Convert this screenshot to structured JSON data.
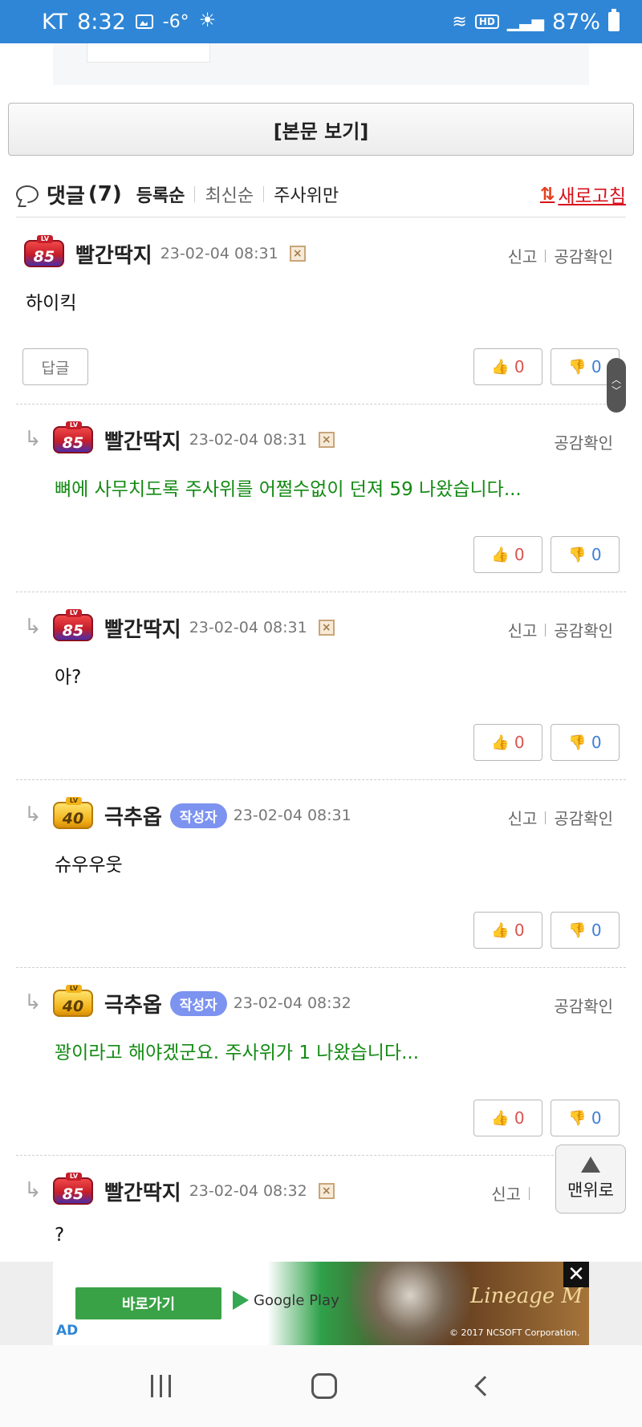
{
  "status_bar": {
    "carrier": "KT",
    "time": "8:32",
    "temperature": "-6°",
    "hd": "HD",
    "battery": "87%"
  },
  "view_body_button": "[본문 보기]",
  "comments_header": {
    "title": "댓글",
    "count": "(7)",
    "sort_options": [
      "등록순",
      "최신순",
      "주사위만"
    ],
    "refresh_label": "새로고침"
  },
  "labels": {
    "report": "신고",
    "sympathy": "공감확인",
    "reply": "답글",
    "author": "작성자",
    "lv": "LV"
  },
  "comments": [
    {
      "level": "85",
      "nick": "빨간딱지",
      "date": "23-02-04 08:31",
      "text": "하이킥",
      "up": "0",
      "down": "0"
    },
    {
      "level": "85",
      "nick": "빨간딱지",
      "date": "23-02-04 08:31",
      "text": "뼈에 사무치도록 주사위를 어쩔수없이 던져 59 나왔습니다...",
      "up": "0",
      "down": "0"
    },
    {
      "level": "85",
      "nick": "빨간딱지",
      "date": "23-02-04 08:31",
      "text": "아?",
      "up": "0",
      "down": "0"
    },
    {
      "level": "40",
      "nick": "극추옵",
      "date": "23-02-04 08:31",
      "text": "슈우우웃",
      "up": "0",
      "down": "0"
    },
    {
      "level": "40",
      "nick": "극추옵",
      "date": "23-02-04 08:32",
      "text": "꽝이라고 해야겠군요. 주사위가 1 나왔습니다...",
      "up": "0",
      "down": "0"
    },
    {
      "level": "85",
      "nick": "빨간딱지",
      "date": "23-02-04 08:32",
      "text": "?"
    }
  ],
  "top_button": "맨위로",
  "ad": {
    "go_button": "바로가기",
    "store": "Google Play",
    "game": "Lineage M",
    "copyright": "© 2017 NCSOFT Corporation.",
    "ad_label": "AD"
  },
  "colors": {
    "status_bar": "#2f86d6",
    "refresh": "#d8121d",
    "green_text": "#138a13",
    "author_badge": "#7d93f0",
    "vote_up": "#d9534f",
    "vote_down": "#3e7fd6"
  }
}
